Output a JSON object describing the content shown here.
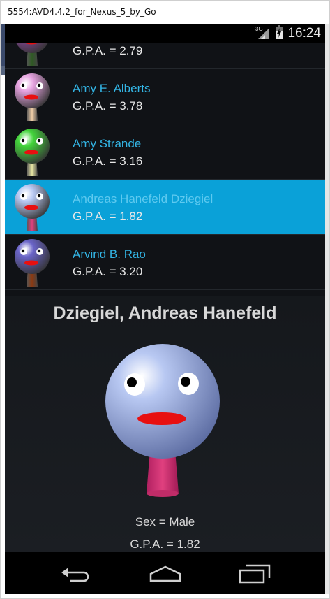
{
  "window": {
    "title": "5554:AVD4.4.2_for_Nexus_5_by_Go"
  },
  "statusbar": {
    "network": "3G",
    "time": "16:24"
  },
  "list": {
    "items": [
      {
        "name": "",
        "gpa": "G.P.A. = 2.79",
        "head_color": "#8e4aa0",
        "neck_color": "#2f5a24"
      },
      {
        "name": "Amy E. Alberts",
        "gpa": "G.P.A. = 3.78",
        "head_color": "#e6a3e0",
        "neck_color": "#f2cfa8"
      },
      {
        "name": "Amy Strande",
        "gpa": "G.P.A. = 3.16",
        "head_color": "#43d43b",
        "neck_color": "#e8e7a4"
      },
      {
        "name": "Andreas Hanefeld Dziegiel",
        "gpa": "G.P.A. = 1.82",
        "head_color": "#b8c8f2",
        "neck_color": "#e0407f",
        "selected": true
      },
      {
        "name": "Arvind B. Rao",
        "gpa": "G.P.A. = 3.20",
        "head_color": "#6a64c8",
        "neck_color": "#8b3a12"
      }
    ]
  },
  "detail": {
    "name": "Dziegiel, Andreas Hanefeld",
    "sex": "Sex = Male",
    "gpa": "G.P.A. = 1.82",
    "head_color": "#b8c8f2",
    "neck_color": "#e0407f"
  },
  "colors": {
    "accent": "#33b5e5",
    "selected_row": "#0aa1d8",
    "mouth": "#e81010"
  }
}
